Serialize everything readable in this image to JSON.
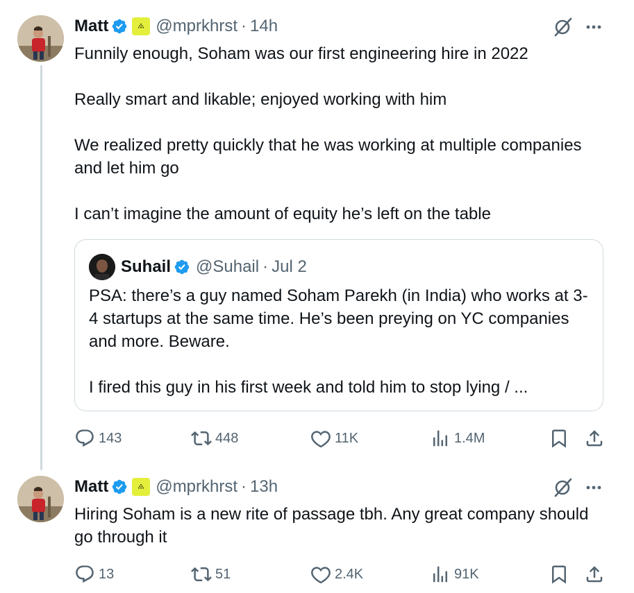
{
  "tweet1": {
    "name": "Matt",
    "handle": "@mprkhrst",
    "separator": "·",
    "time": "14h",
    "text": "Funnily enough, Soham was our first engineering hire in 2022\n\nReally smart and likable; enjoyed working with him\n\nWe realized pretty quickly that he was working at multiple companies and let him go\n\nI can’t imagine the amount of equity he’s left on the table",
    "quote": {
      "name": "Suhail",
      "handle": "@Suhail",
      "separator": "·",
      "time": "Jul 2",
      "text": "PSA: there’s a guy named Soham Parekh (in India) who works at 3-4 startups at the same time. He’s been preying on YC companies and more. Beware.\n\nI fired this guy in his first week and told him to stop lying / ..."
    },
    "stats": {
      "replies": "143",
      "reposts": "448",
      "likes": "11K",
      "views": "1.4M"
    }
  },
  "tweet2": {
    "name": "Matt",
    "handle": "@mprkhrst",
    "separator": "·",
    "time": "13h",
    "text": "Hiring Soham is a new rite of passage tbh. Any great company should go through it",
    "stats": {
      "replies": "13",
      "reposts": "51",
      "likes": "2.4K",
      "views": "91K"
    }
  },
  "colors": {
    "text": "#0f1419",
    "secondary": "#536471",
    "verified": "#1d9bf0",
    "affiliate_badge": "#e3ef3a",
    "border": "#cfd9de"
  },
  "icons": [
    "verified-icon",
    "affiliate-badge-icon",
    "grok-icon",
    "more-icon",
    "reply-icon",
    "repost-icon",
    "like-icon",
    "views-icon",
    "bookmark-icon",
    "share-icon"
  ]
}
